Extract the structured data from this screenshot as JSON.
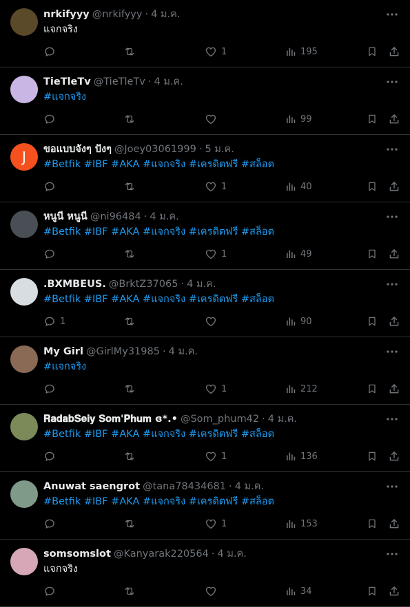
{
  "colors": {
    "background": "#000000",
    "text": "#e7e9ea",
    "muted": "#71767b",
    "link": "#1d9bf0",
    "divider": "#2f3336"
  },
  "tweets": [
    {
      "name": "nrkifyyy",
      "handle": "@nrkifyyy",
      "sep": "·",
      "date": "4 ม.ค.",
      "text": "แจกจริง",
      "is_hashtag": false,
      "replies": "",
      "retweets": "",
      "likes": "1",
      "views": "195",
      "avatar_color": "#5a4a2a",
      "avatar_letter": ""
    },
    {
      "name": "TieTleTv",
      "handle": "@TieTleTv",
      "sep": "·",
      "date": "4 ม.ค.",
      "text": "#แจกจริง",
      "is_hashtag": true,
      "replies": "",
      "retweets": "",
      "likes": "",
      "views": "99",
      "avatar_color": "#c9b6e4",
      "avatar_letter": ""
    },
    {
      "name": "ขอแบบจังๆ ปังๆ",
      "handle": "@Joey03061999",
      "sep": "·",
      "date": "5 ม.ค.",
      "text": "#Betfik #IBF #AKA #แจกจริง #เครดิตฟรี #สล็อต",
      "is_hashtag": true,
      "replies": "",
      "retweets": "",
      "likes": "1",
      "views": "40",
      "avatar_color": "#f4511e",
      "avatar_letter": "J"
    },
    {
      "name": "หนูนี หนูนี",
      "handle": "@ni96484",
      "sep": "·",
      "date": "4 ม.ค.",
      "text": "#Betfik #IBF #AKA #แจกจริง #เครดิตฟรี #สล็อต",
      "is_hashtag": true,
      "replies": "",
      "retweets": "",
      "likes": "1",
      "views": "49",
      "avatar_color": "#4a4e55",
      "avatar_letter": ""
    },
    {
      "name": ".BXMBEUS.",
      "handle": "@BrktZ37065",
      "sep": "·",
      "date": "4 ม.ค.",
      "text": "#Betfik #IBF #AKA #แจกจริง #เครดิตฟรี #สล็อต",
      "is_hashtag": true,
      "replies": "1",
      "retweets": "",
      "likes": "",
      "views": "90",
      "avatar_color": "#d8dde2",
      "avatar_letter": ""
    },
    {
      "name": "My Girl",
      "handle": "@GirlMy31985",
      "sep": "·",
      "date": "4 ม.ค.",
      "text": "#แจกจริง",
      "is_hashtag": true,
      "replies": "",
      "retweets": "",
      "likes": "1",
      "views": "212",
      "avatar_color": "#8a6a55",
      "avatar_letter": ""
    },
    {
      "name": "𝐑𝐚𝐝𝐚𝐛𝐒𝐞𝐢𝐲 𝐒𝐨𝐦'𝐏𝐡𝐮𝐦 ɞ*.•",
      "handle": "@Som_phum42",
      "sep": "·",
      "date": "4 ม.ค.",
      "text": "#Betfik #IBF #AKA #แจกจริง #เครดิตฟรี #สล็อต",
      "is_hashtag": true,
      "replies": "",
      "retweets": "",
      "likes": "1",
      "views": "136",
      "avatar_color": "#7c8a5a",
      "avatar_letter": ""
    },
    {
      "name": "Anuwat saengrot",
      "handle": "@tana78434681",
      "sep": "·",
      "date": "4 ม.ค.",
      "text": "#Betfik #IBF #AKA #แจกจริง #เครดิตฟรี #สล็อต",
      "is_hashtag": true,
      "replies": "",
      "retweets": "",
      "likes": "1",
      "views": "153",
      "avatar_color": "#7f9a88",
      "avatar_letter": ""
    },
    {
      "name": "somsomslot",
      "handle": "@Kanyarak220564",
      "sep": "·",
      "date": "4 ม.ค.",
      "text": "แจกจริง",
      "is_hashtag": false,
      "replies": "",
      "retweets": "",
      "likes": "",
      "views": "34",
      "avatar_color": "#d6a7b6",
      "avatar_letter": ""
    }
  ]
}
